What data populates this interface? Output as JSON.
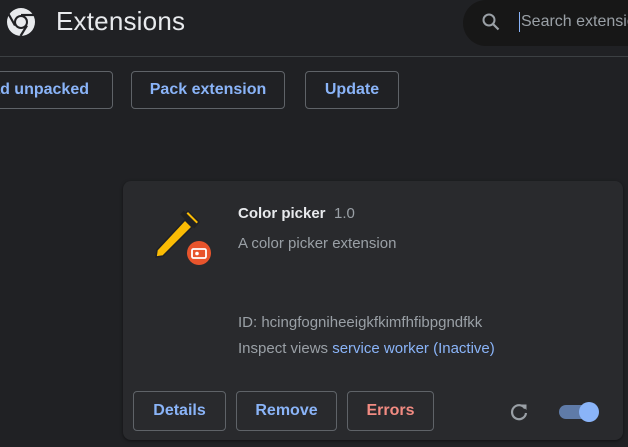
{
  "header": {
    "title": "Extensions",
    "logo_icon": "chrome-logo-icon",
    "search": {
      "placeholder": "Search extensions",
      "value": "",
      "icon": "search-icon"
    }
  },
  "toolbar": {
    "load_unpacked_label": "Load unpacked",
    "load_unpacked_visible": "ad unpacked",
    "pack_extension_label": "Pack extension",
    "update_label": "Update"
  },
  "extension": {
    "name": "Color picker",
    "version": "1.0",
    "description": "A color picker extension",
    "id_text": "ID: hcingfogniheeigkfkimfhfibpgndfkk",
    "inspect_label": "Inspect views",
    "inspect_link": "service worker (Inactive)",
    "enabled": true,
    "icon": "eyedropper-icon",
    "badge_icon": "unpacked-badge-icon",
    "buttons": {
      "details": "Details",
      "remove": "Remove",
      "errors": "Errors"
    },
    "reload_icon": "reload-icon"
  },
  "colors": {
    "background": "#202124",
    "card": "#292a2d",
    "accent": "#8ab4f8",
    "error": "#f28b82",
    "icon_yellow": "#fbbc04",
    "badge_red": "#e8542c"
  }
}
